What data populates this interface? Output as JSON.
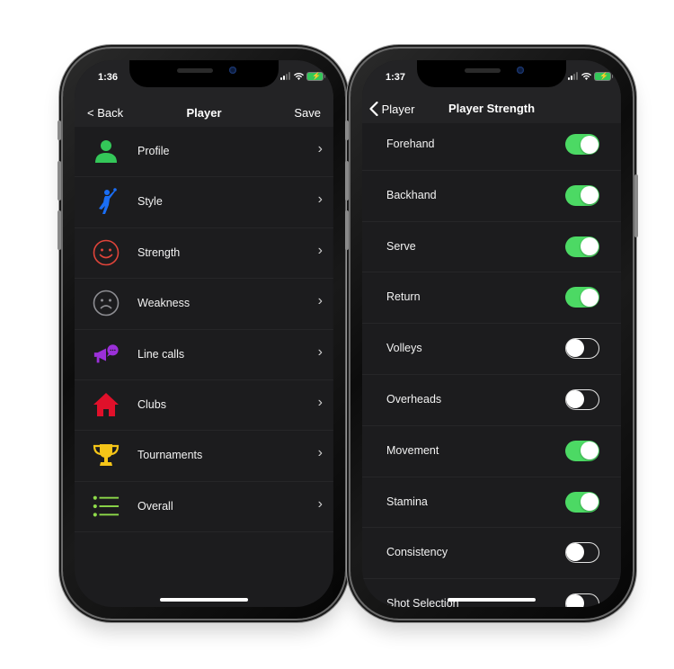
{
  "left_screen": {
    "status": {
      "time": "1:36"
    },
    "nav": {
      "back_label": "< Back",
      "title": "Player",
      "save_label": "Save"
    },
    "items": [
      {
        "label": "Profile",
        "icon": "person-icon",
        "color": "#34c759"
      },
      {
        "label": "Style",
        "icon": "tennis-player-icon",
        "color": "#1a6ef5"
      },
      {
        "label": "Strength",
        "icon": "smiley-face-icon",
        "color": "#e0443a"
      },
      {
        "label": "Weakness",
        "icon": "frown-face-icon",
        "color": "#8e8e93"
      },
      {
        "label": "Line calls",
        "icon": "megaphone-chat-icon",
        "color": "#9b30d9"
      },
      {
        "label": "Clubs",
        "icon": "house-icon",
        "color": "#e0102a"
      },
      {
        "label": "Tournaments",
        "icon": "trophy-icon",
        "color": "#f5c518"
      },
      {
        "label": "Overall",
        "icon": "list-icon",
        "color": "#8fdc4a"
      }
    ]
  },
  "right_screen": {
    "status": {
      "time": "1:37"
    },
    "nav": {
      "back_label": "Player",
      "title": "Player Strength"
    },
    "toggles": [
      {
        "label": "Forehand",
        "on": true
      },
      {
        "label": "Backhand",
        "on": true
      },
      {
        "label": "Serve",
        "on": true
      },
      {
        "label": "Return",
        "on": true
      },
      {
        "label": "Volleys",
        "on": false
      },
      {
        "label": "Overheads",
        "on": false
      },
      {
        "label": "Movement",
        "on": true
      },
      {
        "label": "Stamina",
        "on": true
      },
      {
        "label": "Consistency",
        "on": false
      },
      {
        "label": "Shot Selection",
        "on": false
      }
    ]
  },
  "colors": {
    "toggle_on": "#4cd964",
    "background": "#1c1c1e",
    "bar": "#232325"
  }
}
